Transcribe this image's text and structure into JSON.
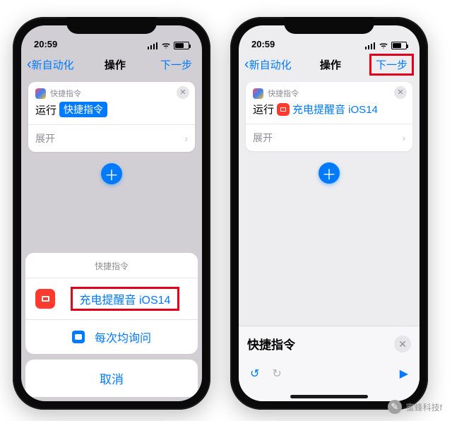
{
  "status": {
    "time": "20:59"
  },
  "nav": {
    "back": "新自动化",
    "title": "操作",
    "next": "下一步"
  },
  "card": {
    "app_label": "快捷指令",
    "prefix": "运行",
    "placeholder_pill": "快捷指令",
    "selected_shortcut": "充电提醒音 iOS14",
    "expand": "展开"
  },
  "sheet": {
    "title": "快捷指令",
    "shortcut_option": "充电提醒音 iOS14",
    "ask_each_time": "每次均询问",
    "cancel": "取消"
  },
  "panel": {
    "title": "快捷指令"
  },
  "watermark": {
    "text": "蜜蜂科技f"
  }
}
